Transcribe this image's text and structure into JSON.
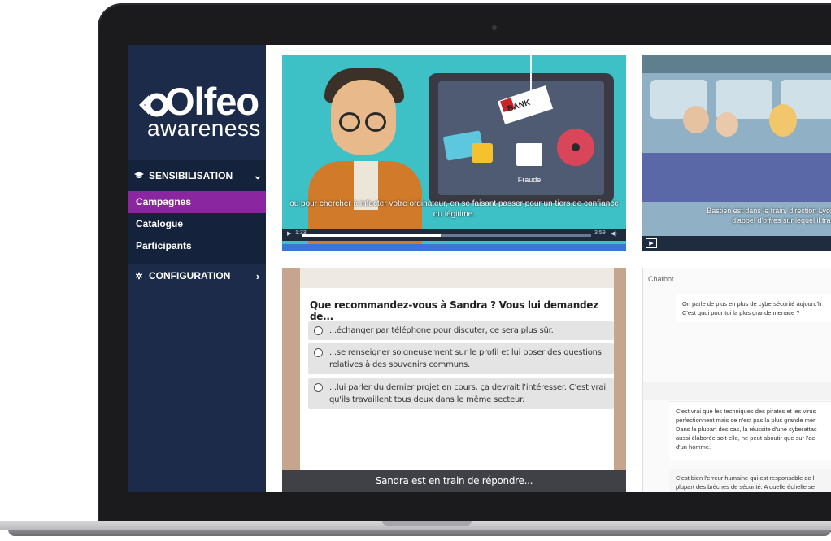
{
  "brand": {
    "name": "Olfeo",
    "word": "Olfeo",
    "subtitle": "awareness"
  },
  "sidebar": {
    "sections": [
      {
        "icon": "graduation-cap-icon",
        "label": "SENSIBILISATION",
        "expanded": true,
        "items": [
          {
            "label": "Campagnes",
            "active": true
          },
          {
            "label": "Catalogue",
            "active": false
          },
          {
            "label": "Participants",
            "active": false
          }
        ]
      },
      {
        "icon": "gear-icon",
        "label": "CONFIGURATION",
        "expanded": false
      }
    ]
  },
  "video1": {
    "bank_label": "BANK",
    "screen_label": "Fraude",
    "subtitle": "ou pour chercher à infecter votre ordinateur, en se faisant passer pour un tiers de confiance ou  légitime.",
    "time_current": "1:33",
    "time_total": "3:59",
    "progress": 0.48
  },
  "video2": {
    "subtitle_line1": "Bastien est dans le train, direction Lyon",
    "subtitle_line2": "d'appel d'offres sur lequel il trav"
  },
  "quiz": {
    "question": "Que recommandez-vous à Sandra ? Vous lui demandez de...",
    "options": [
      "...échanger par téléphone pour discuter, ce sera plus sûr.",
      "...se renseigner soigneusement sur le profil et lui poser des questions relatives à des souvenirs communs.",
      "...lui parler du dernier projet en cours, ça devrait l'intéresser. C'est vrai qu'ils travaillent tous deux dans le même secteur."
    ],
    "footer": "Sandra est en train de répondre..."
  },
  "chatbot": {
    "title": "Chatbot",
    "messages": [
      [
        "On parle de plus en plus de cybersécurité aujourd'h",
        "C'est quoi pour toi la plus grande menace ?"
      ],
      [
        "C'est vrai que les techniques des pirates et les virus",
        "perfectionnent mais ce n'est pas la plus grande mer",
        "Dans la plupart des cas, la réussite d'une cyberattac",
        "aussi élaborée soit-elle, ne peut aboutir que sur l'ac",
        "d'un homme."
      ],
      [
        "C'est bien l'erreur humaine qui est responsable de l",
        "plupart des brèches de sécurité. A quelle échelle se"
      ]
    ]
  },
  "colors": {
    "sidebar_bg": "#1c2b4a",
    "active_item": "#8a27a0",
    "video_teal": "#3ec1c6"
  }
}
